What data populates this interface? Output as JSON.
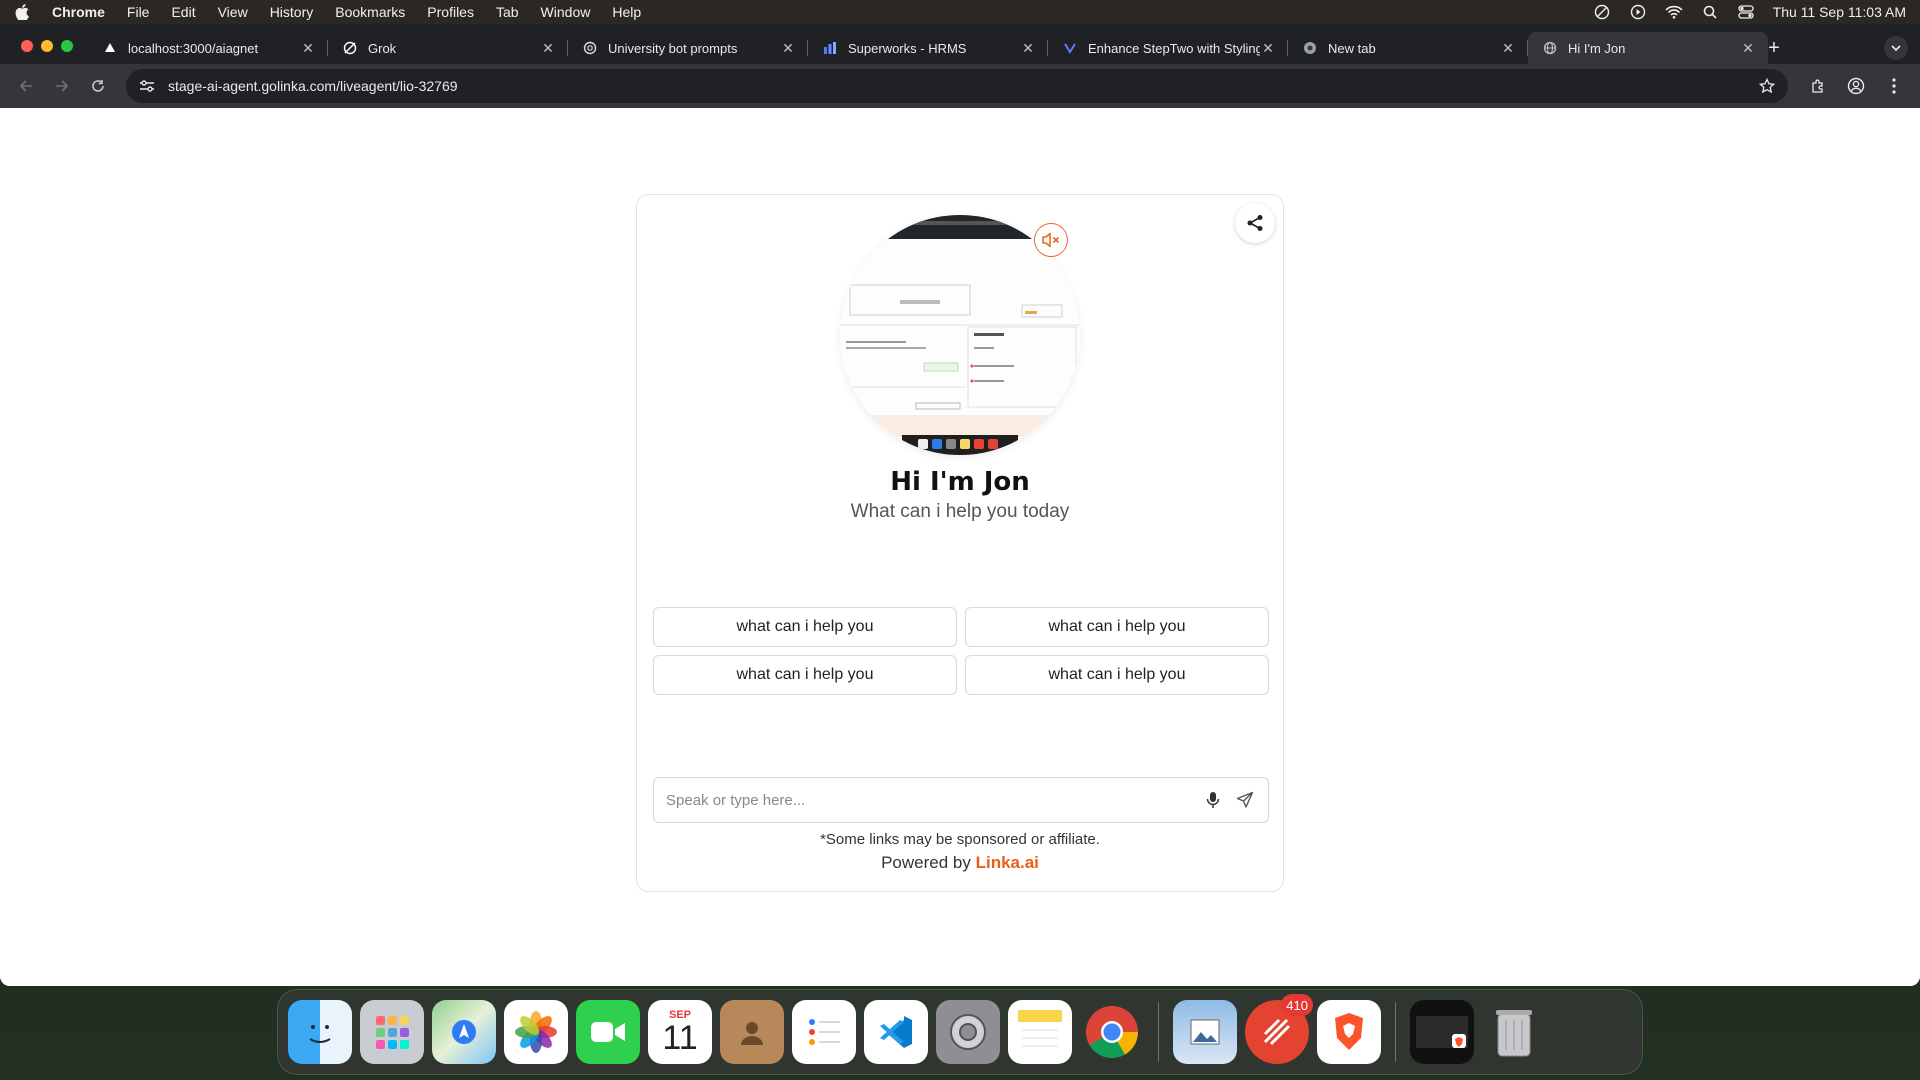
{
  "menubar": {
    "app": "Chrome",
    "items": [
      "File",
      "Edit",
      "View",
      "History",
      "Bookmarks",
      "Profiles",
      "Tab",
      "Window",
      "Help"
    ],
    "clock": "Thu 11 Sep  11:03 AM"
  },
  "tabs": [
    {
      "title": "localhost:3000/aiagnet",
      "icon": "vercel-icon"
    },
    {
      "title": "Grok",
      "icon": "grok-icon"
    },
    {
      "title": "University bot prompts",
      "icon": "chatgpt-icon"
    },
    {
      "title": "Superworks - HRMS",
      "icon": "superworks-icon"
    },
    {
      "title": "Enhance StepTwo with Styling",
      "icon": "claude-icon"
    },
    {
      "title": "New tab",
      "icon": "chrome-icon"
    },
    {
      "title": "Hi I'm Jon",
      "icon": "globe-icon",
      "active": true
    }
  ],
  "address_bar": {
    "url": "stage-ai-agent.golinka.com/liveagent/lio-32769"
  },
  "agent": {
    "greeting": "Hi I'm Jon",
    "subtitle": "What can i help you today",
    "suggestions": [
      "what can i help you",
      "what can i help you",
      "what can i help you",
      "what can i help you"
    ],
    "input_placeholder": "Speak or type here...",
    "disclaimer": "*Some links may be sponsored or affiliate.",
    "powered_prefix": "Powered by",
    "powered_brand": "Linka.ai",
    "brand_color": "#e8601c"
  },
  "dock": {
    "calendar_month": "SEP",
    "calendar_day": "11",
    "badge_count": "410"
  }
}
